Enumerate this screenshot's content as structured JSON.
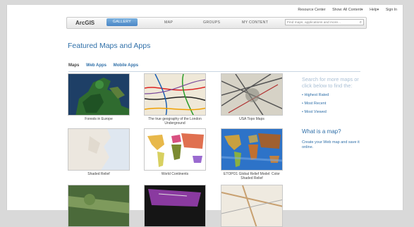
{
  "utility": {
    "resource_center": "Resource Center",
    "show": "Show: All Content▾",
    "help": "Help▾",
    "sign_in": "Sign In"
  },
  "nav": {
    "logo": "ArcGIS",
    "tabs": [
      "GALLERY",
      "MAP",
      "GROUPS",
      "MY CONTENT"
    ],
    "search_placeholder": "Find maps, applications and more..."
  },
  "title": "Featured Maps and Apps",
  "filters": [
    "Maps",
    "Web Apps",
    "Mobile Apps"
  ],
  "cards": [
    {
      "caption": "Forests in Europe"
    },
    {
      "caption": "The true geography of the London Underground"
    },
    {
      "caption": "USA Topo Maps"
    },
    {
      "caption": "Shaded Relief"
    },
    {
      "caption": "World Continents"
    },
    {
      "caption": "ETOPO1 Global Relief Model: Color Shaded Relief"
    },
    {
      "caption": ""
    },
    {
      "caption": ""
    },
    {
      "caption": ""
    }
  ],
  "sidebar": {
    "heading": "Search for more maps or click below to find the:",
    "links": [
      "Highest Rated",
      "Most Recent",
      "Most Viewed"
    ],
    "what_is": "What is a map?",
    "create_text": "Create your Web map and save it online."
  },
  "colors": {
    "accent": "#2f6fa8",
    "tab_active": "#5b95d0"
  }
}
